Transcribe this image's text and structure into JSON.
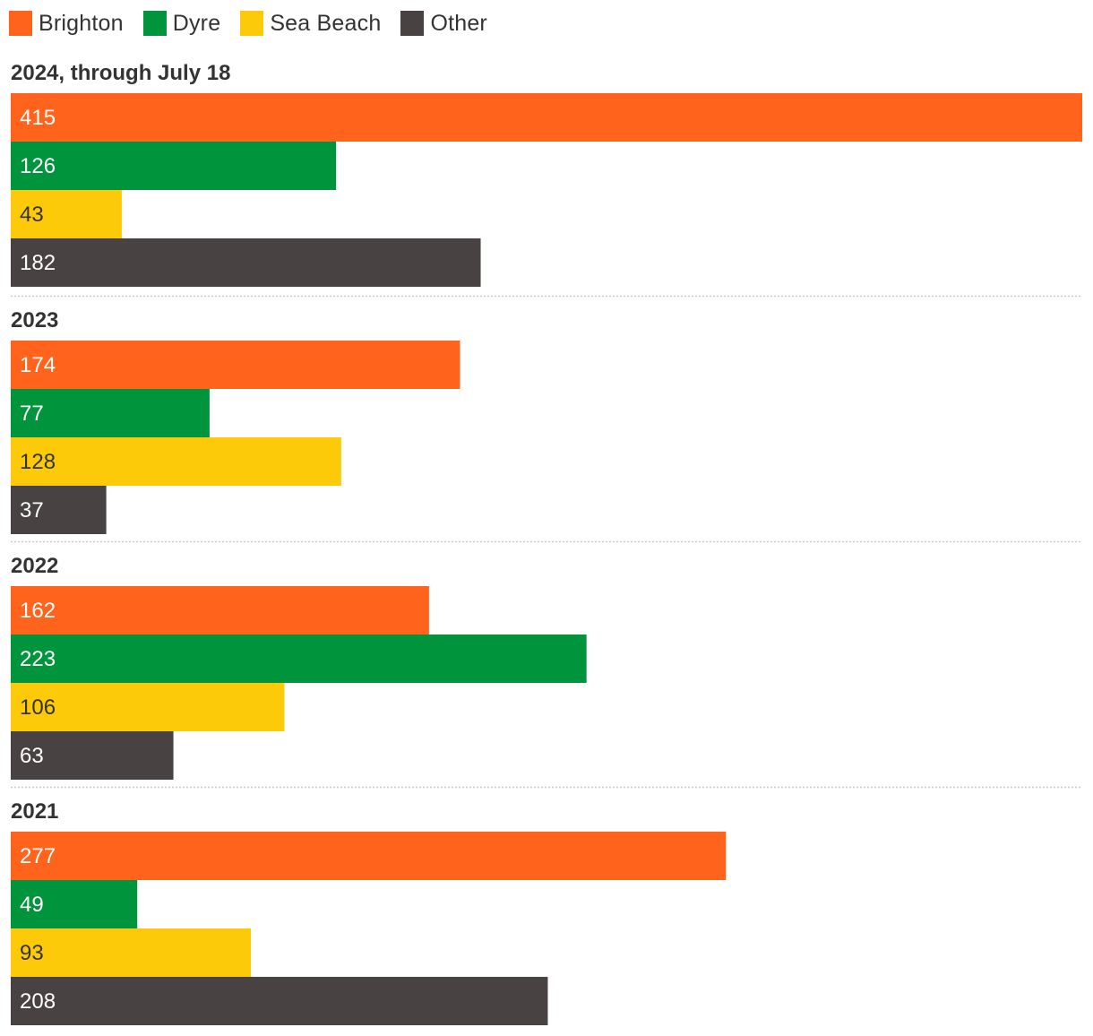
{
  "chart_data": {
    "type": "bar",
    "orientation": "horizontal",
    "title": "",
    "xlabel": "",
    "ylabel": "",
    "xlim": [
      0,
      415
    ],
    "grid": false,
    "legend_position": "top-left",
    "series_names": [
      "Brighton",
      "Dyre",
      "Sea Beach",
      "Other"
    ],
    "colors": {
      "Brighton": "#ff631c",
      "Dyre": "#00943c",
      "Sea Beach": "#fdca0a",
      "Other": "#484342"
    },
    "label_colors": {
      "Brighton": "#ffffff",
      "Dyre": "#ffffff",
      "Sea Beach": "#333333",
      "Other": "#ffffff"
    },
    "groups": [
      {
        "title": "2024, through July 18",
        "values": [
          415,
          126,
          43,
          182
        ]
      },
      {
        "title": "2023",
        "values": [
          174,
          77,
          128,
          37
        ]
      },
      {
        "title": "2022",
        "values": [
          162,
          223,
          106,
          63
        ]
      },
      {
        "title": "2021",
        "values": [
          277,
          49,
          93,
          208
        ]
      }
    ]
  },
  "legend": {
    "items": [
      {
        "label": "Brighton",
        "color": "#ff631c"
      },
      {
        "label": "Dyre",
        "color": "#00943c"
      },
      {
        "label": "Sea Beach",
        "color": "#fdca0a"
      },
      {
        "label": "Other",
        "color": "#484342"
      }
    ]
  }
}
